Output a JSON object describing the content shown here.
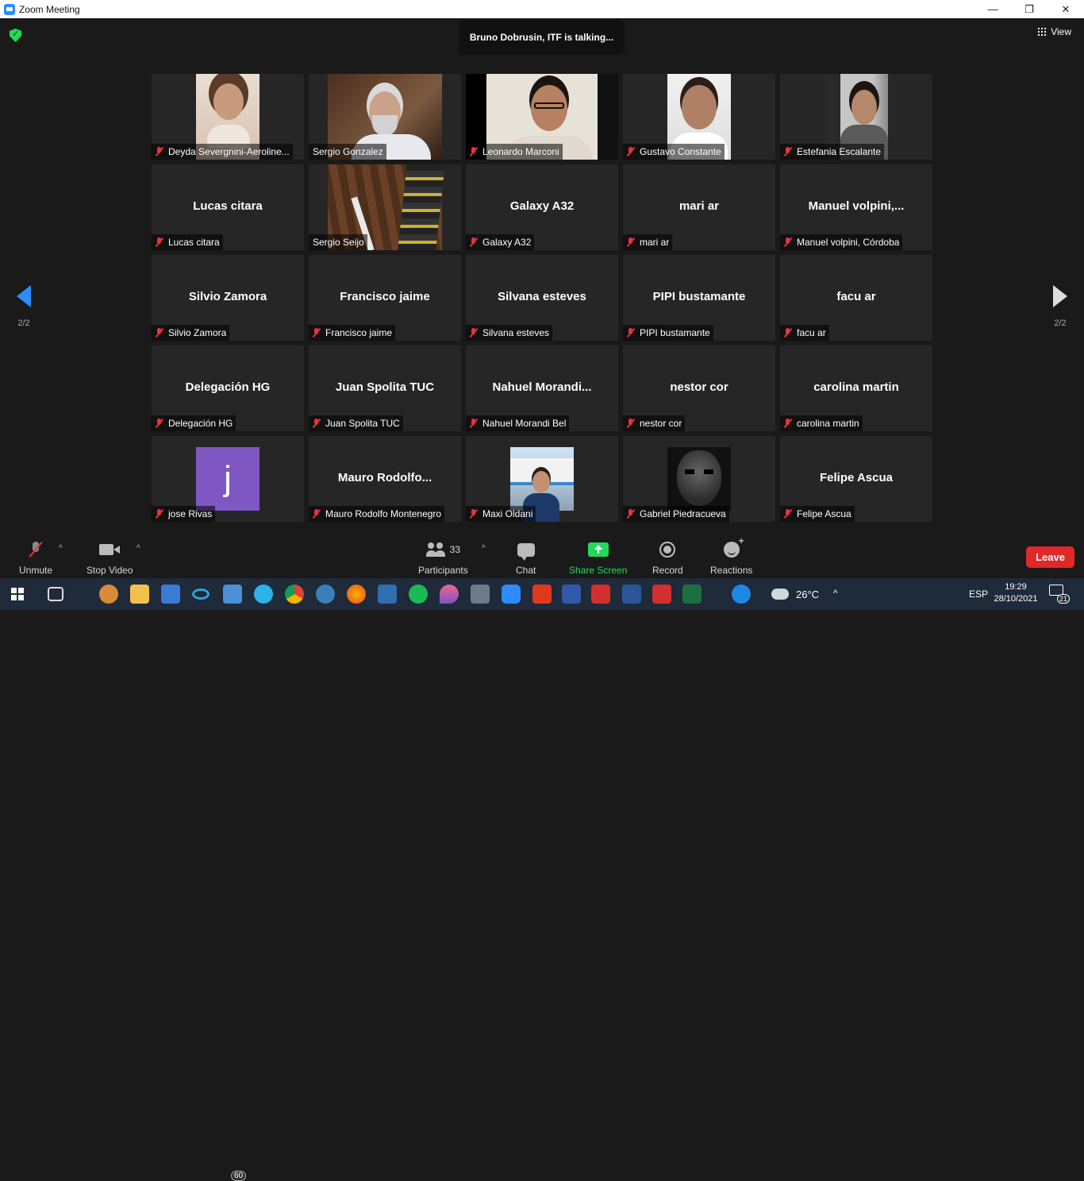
{
  "window": {
    "title": "Zoom Meeting",
    "controls": {
      "minimize": "—",
      "maximize": "❐",
      "close": "✕"
    }
  },
  "meeting": {
    "talking_banner": "Bruno Dobrusin, ITF is talking...",
    "view_label": "View",
    "page_left": "2/2",
    "page_right": "2/2"
  },
  "tiles": [
    {
      "name": "Deyda Severgnini-Aerolineas",
      "display": "Deyda Severgnini-Aeroline...",
      "muted": true,
      "video": true
    },
    {
      "name": "Sergio Gonzalez",
      "display": "Sergio Gonzalez",
      "muted": false,
      "video": true
    },
    {
      "name": "Leonardo Marconi",
      "display": "Leonardo Marconi",
      "muted": true,
      "video": true
    },
    {
      "name": "Gustavo Constante",
      "display": "Gustavo Constante",
      "muted": true,
      "video": true
    },
    {
      "name": "Estefania Escalante",
      "display": "Estefania Escalante",
      "muted": true,
      "video": true
    },
    {
      "name": "Lucas citara",
      "display": "Lucas citara",
      "muted": true,
      "video": false,
      "big": "Lucas citara"
    },
    {
      "name": "Sergio Seijo",
      "display": "Sergio Seijo",
      "muted": false,
      "video": true
    },
    {
      "name": "Galaxy A32",
      "display": "Galaxy A32",
      "muted": true,
      "video": false,
      "big": "Galaxy A32"
    },
    {
      "name": "mari ar",
      "display": "mari ar",
      "muted": true,
      "video": false,
      "big": "mari ar"
    },
    {
      "name": "Manuel volpini, Córdoba",
      "display": "Manuel volpini, Córdoba",
      "muted": true,
      "video": false,
      "big": "Manuel  volpini,..."
    },
    {
      "name": "Silvio Zamora",
      "display": "Silvio Zamora",
      "muted": true,
      "video": false,
      "big": "Silvio Zamora"
    },
    {
      "name": "Francisco jaime",
      "display": "Francisco jaime",
      "muted": true,
      "video": false,
      "big": "Francisco jaime"
    },
    {
      "name": "Silvana esteves",
      "display": "Silvana esteves",
      "muted": true,
      "video": false,
      "big": "Silvana esteves"
    },
    {
      "name": "PIPI bustamante",
      "display": "PIPI bustamante",
      "muted": true,
      "video": false,
      "big": "PIPI bustamante"
    },
    {
      "name": "facu ar",
      "display": "facu ar",
      "muted": true,
      "video": false,
      "big": "facu ar"
    },
    {
      "name": "Delegación HG",
      "display": "Delegación HG",
      "muted": true,
      "video": false,
      "big": "Delegación HG"
    },
    {
      "name": "Juan Spolita TUC",
      "display": "Juan Spolita TUC",
      "muted": true,
      "video": false,
      "big": "Juan Spolita TUC"
    },
    {
      "name": "Nahuel Morandi Bel",
      "display": "Nahuel Morandi Bel",
      "muted": true,
      "video": false,
      "big": "Nahuel  Morandi..."
    },
    {
      "name": "nestor cor",
      "display": "nestor cor",
      "muted": true,
      "video": false,
      "big": "nestor cor"
    },
    {
      "name": "carolina martin",
      "display": "carolina martin",
      "muted": true,
      "video": false,
      "big": "carolina martin"
    },
    {
      "name": "jose Rivas",
      "display": "jose Rivas",
      "muted": true,
      "video": true,
      "avatar_letter": "j",
      "avatar_color": "#7e57c2"
    },
    {
      "name": "Mauro Rodolfo Montenegro",
      "display": "Mauro Rodolfo Montenegro",
      "muted": true,
      "video": false,
      "big": "Mauro  Rodolfo..."
    },
    {
      "name": "Maxi Oldani",
      "display": "Maxi Oldani",
      "muted": true,
      "video": true
    },
    {
      "name": "Gabriel Piedracueva",
      "display": "Gabriel Piedracueva",
      "muted": true,
      "video": true
    },
    {
      "name": "Felipe Ascua",
      "display": "Felipe Ascua",
      "muted": true,
      "video": false,
      "big": "Felipe Ascua"
    }
  ],
  "toolbar": {
    "unmute": "Unmute",
    "stop_video": "Stop Video",
    "participants": "Participants",
    "participants_count": "33",
    "chat": "Chat",
    "share_screen": "Share Screen",
    "record": "Record",
    "reactions": "Reactions",
    "leave": "Leave",
    "share_color": "#23d959",
    "leave_color": "#e02828"
  },
  "taskbar": {
    "mail_badge": "60",
    "weather": "26°C",
    "language": "ESP",
    "time": "19:29",
    "date": "28/10/2021",
    "notifications": "21"
  }
}
